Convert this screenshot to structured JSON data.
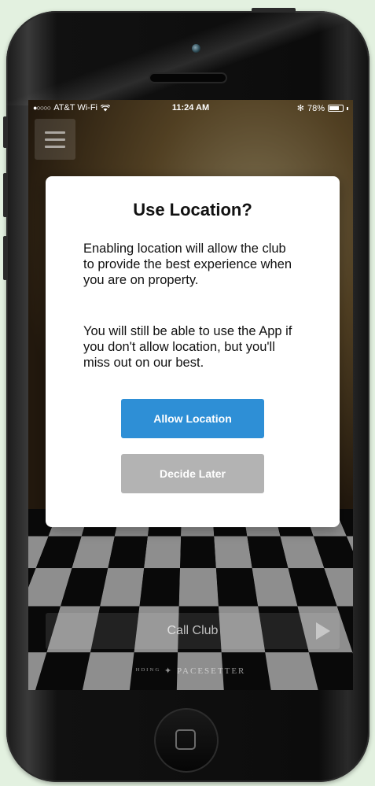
{
  "status_bar": {
    "signal": "●○○○○",
    "carrier": "AT&T Wi-Fi",
    "wifi_icon": "wifi-icon",
    "time": "11:24 AM",
    "bluetooth": "✻",
    "battery_percent": "78%",
    "battery_level": 0.78
  },
  "dialog": {
    "title": "Use Location?",
    "paragraph1": "Enabling location will allow the club to provide the best experience when you are on property.",
    "paragraph2": "You will still be able to use the App if you don't allow location, but you'll miss out on our best.",
    "allow_label": "Allow Location",
    "decide_later_label": "Decide Later"
  },
  "app": {
    "call_club_label": "Call Club",
    "brand_text": "ᴴᴰᴵᴺᴳ ✦ PACESETTER"
  },
  "colors": {
    "allow_button": "#2e8fd6",
    "decide_later_button": "#b3b3b3",
    "page_background": "#e3f1e0"
  }
}
